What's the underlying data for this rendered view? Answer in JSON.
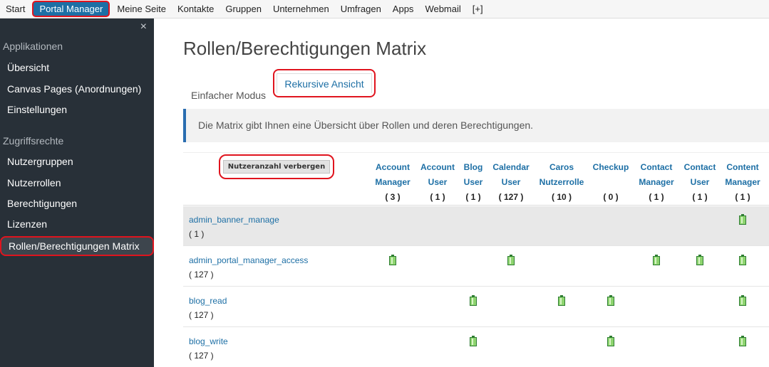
{
  "topnav": {
    "items": [
      {
        "label": "Start",
        "active": false
      },
      {
        "label": "Portal Manager",
        "active": true
      },
      {
        "label": "Meine Seite",
        "active": false
      },
      {
        "label": "Kontakte",
        "active": false
      },
      {
        "label": "Gruppen",
        "active": false
      },
      {
        "label": "Unternehmen",
        "active": false
      },
      {
        "label": "Umfragen",
        "active": false
      },
      {
        "label": "Apps",
        "active": false
      },
      {
        "label": "Webmail",
        "active": false
      },
      {
        "label": "[+]",
        "active": false
      }
    ]
  },
  "sidebar": {
    "close_label": "×",
    "sections": [
      {
        "title": "Applikationen",
        "items": [
          "Übersicht",
          "Canvas Pages (Anordnungen)",
          "Einstellungen"
        ]
      },
      {
        "title": "Zugriffsrechte",
        "items": [
          "Nutzergruppen",
          "Nutzerrollen",
          "Berechtigungen",
          "Lizenzen",
          "Rollen/Berechtigungen Matrix"
        ]
      }
    ],
    "active_item": "Rollen/Berechtigungen Matrix"
  },
  "main": {
    "title": "Rollen/Berechtigungen Matrix",
    "tabs": [
      {
        "label": "Einfacher Modus",
        "active": false
      },
      {
        "label": "Rekursive Ansicht",
        "active": true
      }
    ],
    "info_text": "Die Matrix gibt Ihnen eine Übersicht über Rollen und deren Berechtigungen.",
    "toggle_label": "Nutzeranzahl verbergen"
  },
  "matrix": {
    "columns": [
      {
        "line1": "Account",
        "line2": "Manager",
        "count": "( 3 )"
      },
      {
        "line1": "Account",
        "line2": "User",
        "count": "( 1 )"
      },
      {
        "line1": "Blog",
        "line2": "User",
        "count": "( 1 )"
      },
      {
        "line1": "Calendar",
        "line2": "User",
        "count": "( 127 )"
      },
      {
        "line1": "Caros",
        "line2": "Nutzerrolle",
        "count": "( 10 )"
      },
      {
        "line1": "Checkup",
        "line2": "",
        "count": "( 0 )"
      },
      {
        "line1": "Contact",
        "line2": "Manager",
        "count": "( 1 )"
      },
      {
        "line1": "Contact",
        "line2": "User",
        "count": "( 1 )"
      },
      {
        "line1": "Content",
        "line2": "Manager",
        "count": "( 1 )"
      }
    ],
    "rows": [
      {
        "permission": "admin_banner_manage",
        "count": "( 1 )",
        "granted": [
          false,
          false,
          false,
          false,
          false,
          false,
          false,
          false,
          true
        ]
      },
      {
        "permission": "admin_portal_manager_access",
        "count": "( 127 )",
        "granted": [
          true,
          false,
          false,
          true,
          false,
          false,
          true,
          true,
          true
        ]
      },
      {
        "permission": "blog_read",
        "count": "( 127 )",
        "granted": [
          false,
          false,
          true,
          false,
          true,
          true,
          false,
          false,
          true
        ]
      },
      {
        "permission": "blog_write",
        "count": "( 127 )",
        "granted": [
          false,
          false,
          true,
          false,
          false,
          true,
          false,
          false,
          true
        ]
      }
    ],
    "granted_icon": "battery-icon"
  }
}
